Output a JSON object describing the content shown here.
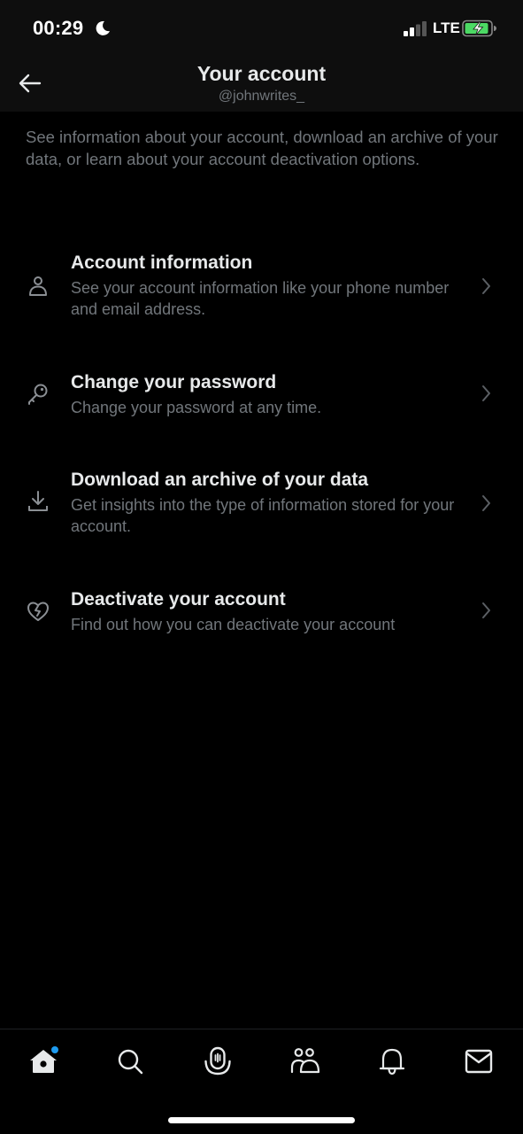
{
  "status_bar": {
    "time": "00:29",
    "network": "LTE",
    "focus_icon": "moon-icon",
    "battery_state": "charging"
  },
  "header": {
    "title": "Your account",
    "handle": "@johnwrites_",
    "back_icon": "arrow-left-icon"
  },
  "intro": "See information about your account, download an archive of your data, or learn about your account deactivation options.",
  "menu": [
    {
      "icon": "person-icon",
      "label": "Account information",
      "description": "See your account information like your phone number and email address."
    },
    {
      "icon": "key-icon",
      "label": "Change your password",
      "description": "Change your password at any time."
    },
    {
      "icon": "download-icon",
      "label": "Download an archive of your data",
      "description": "Get insights into the type of information stored for your account."
    },
    {
      "icon": "broken-heart-icon",
      "label": "Deactivate your account",
      "description": "Find out how you can deactivate your account"
    }
  ],
  "tabbar": {
    "items": [
      {
        "icon": "home-icon",
        "active": true,
        "badge": true
      },
      {
        "icon": "search-icon",
        "active": false
      },
      {
        "icon": "spaces-icon",
        "active": false
      },
      {
        "icon": "communities-icon",
        "active": false
      },
      {
        "icon": "notifications-icon",
        "active": false
      },
      {
        "icon": "messages-icon",
        "active": false
      }
    ]
  },
  "colors": {
    "background": "#000000",
    "header_background": "#0e0e0e",
    "primary_text": "#e7e9ea",
    "secondary_text": "#71767b",
    "accent": "#1d9bf0",
    "battery": "#4cd964"
  }
}
